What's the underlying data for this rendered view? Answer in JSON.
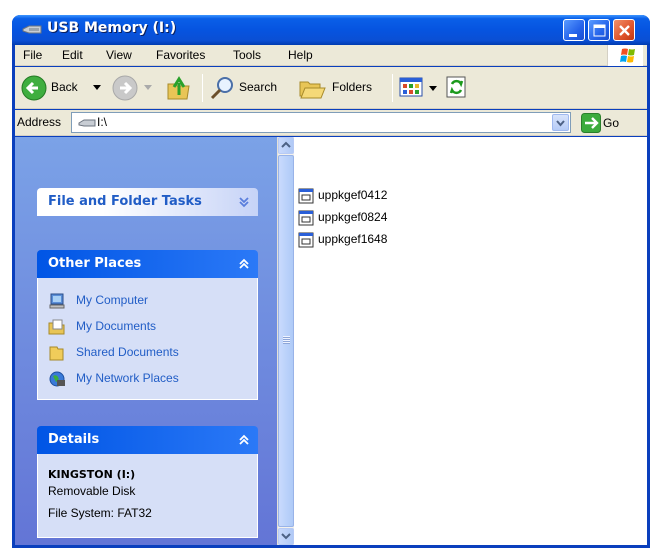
{
  "window": {
    "title": "USB Memory (I:)"
  },
  "menu": {
    "items": [
      "File",
      "Edit",
      "View",
      "Favorites",
      "Tools",
      "Help"
    ]
  },
  "toolbar": {
    "back": "Back",
    "search": "Search",
    "folders": "Folders"
  },
  "address": {
    "label": "Address",
    "value": "I:\\",
    "go": "Go"
  },
  "taskpane": {
    "file_tasks": {
      "title": "File and Folder Tasks"
    },
    "other_places": {
      "title": "Other Places",
      "items": [
        {
          "label": "My Computer",
          "icon": "my-computer-icon"
        },
        {
          "label": "My Documents",
          "icon": "my-documents-icon"
        },
        {
          "label": "Shared Documents",
          "icon": "shared-documents-icon"
        },
        {
          "label": "My Network Places",
          "icon": "network-places-icon"
        }
      ]
    },
    "details": {
      "title": "Details",
      "name": "KINGSTON (I:)",
      "type": "Removable Disk",
      "filesystem": "File System: FAT32"
    }
  },
  "files": [
    {
      "name": "uppkgef0412",
      "icon": "application-file-icon"
    },
    {
      "name": "uppkgef0824",
      "icon": "application-file-icon"
    },
    {
      "name": "uppkgef1648",
      "icon": "application-file-icon"
    }
  ],
  "colors": {
    "titlebar": "#0654e0",
    "taskpane": "#6f8ee0",
    "link": "#215dc6"
  }
}
